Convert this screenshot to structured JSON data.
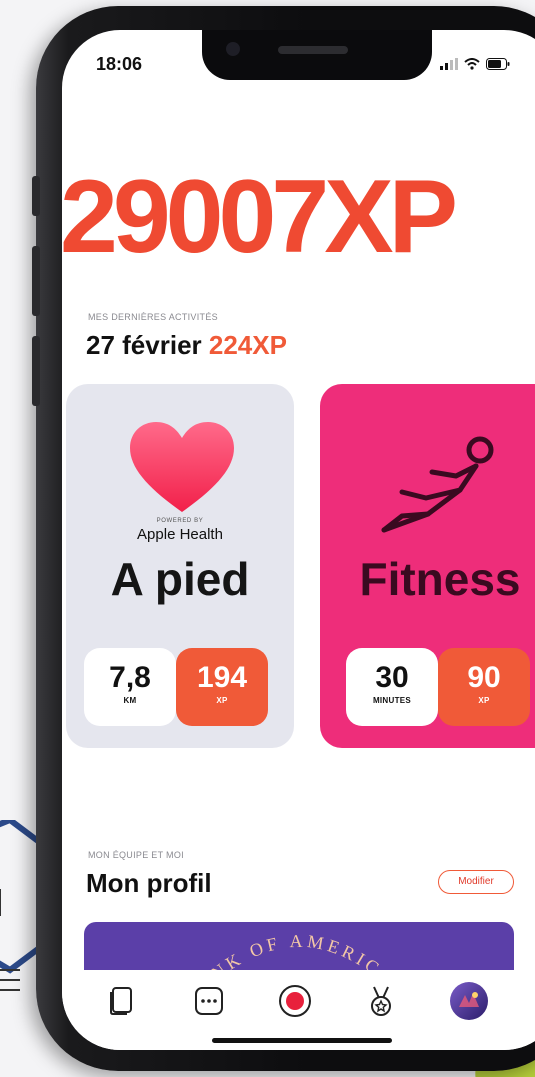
{
  "status_bar": {
    "time": "18:06"
  },
  "xp_total": "29007XP",
  "activities": {
    "section_label": "MES DERNIÈRES ACTIVITÉS",
    "date": "27 février",
    "date_xp": "224XP",
    "cards": [
      {
        "powered_by": "POWERED BY",
        "provider": "Apple Health",
        "title": "A pied",
        "stat_value": "7,8",
        "stat_unit": "KM",
        "xp_value": "194",
        "xp_unit": "XP"
      },
      {
        "title": "Fitness",
        "stat_value": "30",
        "stat_unit": "MINUTES",
        "xp_value": "90",
        "xp_unit": "XP"
      }
    ]
  },
  "profile": {
    "section_label": "MON ÉQUIPE ET MOI",
    "title": "Mon profil",
    "modify_label": "Modifier",
    "banner_text": "NK OF AMERIC"
  },
  "tabbar": {
    "icons": [
      "cards-icon",
      "more-icon",
      "record-icon",
      "medal-icon",
      "avatar-icon"
    ]
  },
  "colors": {
    "accent": "#f05a38",
    "fitness_card": "#ee2d7a",
    "walk_card": "#e5e6ee",
    "banner": "#5b3fa8"
  }
}
